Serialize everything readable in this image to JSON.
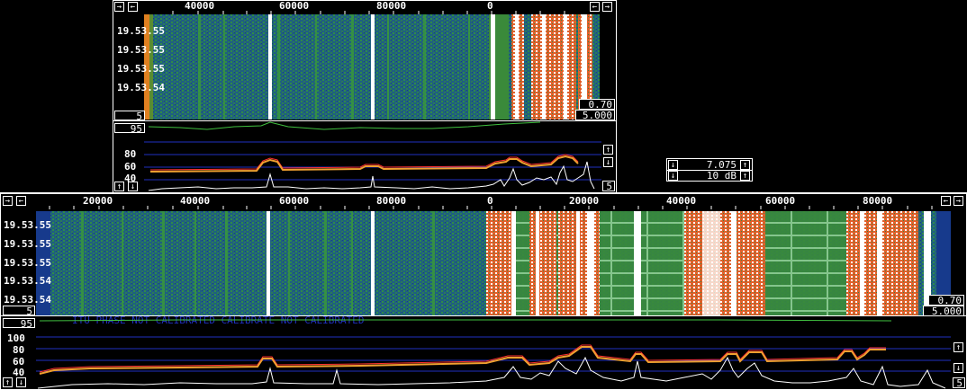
{
  "top": {
    "freq_labels": [
      "40000",
      "60000",
      "80000",
      "0"
    ],
    "time_labels": [
      "19.53.55",
      "19.53.55",
      "19.53.55",
      "19.53.54"
    ],
    "avg_value": "5",
    "gain_value": "0.70",
    "zero_value": "5.000",
    "spec_ref": "95",
    "spec_db_labels": [
      "80",
      "60",
      "40"
    ],
    "spec_right_value": "5",
    "arrow_left": "←",
    "arrow_right": "→",
    "arrow_up": "↑",
    "arrow_down": "↓"
  },
  "control": {
    "value1": "7.075",
    "value2": "10 dB"
  },
  "bottom": {
    "freq_labels": [
      "20000",
      "40000",
      "60000",
      "80000",
      "0",
      "20000",
      "40000",
      "60000",
      "80000"
    ],
    "time_labels": [
      "19.53.55",
      "19.53.55",
      "19.53.55",
      "19.53.54",
      "19.53.54"
    ],
    "avg_value": "5",
    "gain_value": "0.70",
    "zero_value": "5.000",
    "spec_ref": "95",
    "spec_db_labels": [
      "100",
      "80",
      "60",
      "40"
    ],
    "spec_right_value": "5",
    "overlay_text": "ITU PHASE NOT CALIBRATED    CALIBRATE NOT CALIBRATED",
    "arrow_left": "←",
    "arrow_right": "→",
    "arrow_up": "↑",
    "arrow_down": "↓"
  },
  "colors": {
    "waterfall_bg": "#1f5f80",
    "waterfall_green": "#2e8b4a",
    "hot_orange": "#e0602a",
    "white_line": "#ffffff",
    "avg_trace": "#f0a030",
    "peak_trace": "#ff3030",
    "spectrum_trace": "#ffffff",
    "grid_blue": "#2030c0",
    "baseline_green": "#40c040"
  }
}
